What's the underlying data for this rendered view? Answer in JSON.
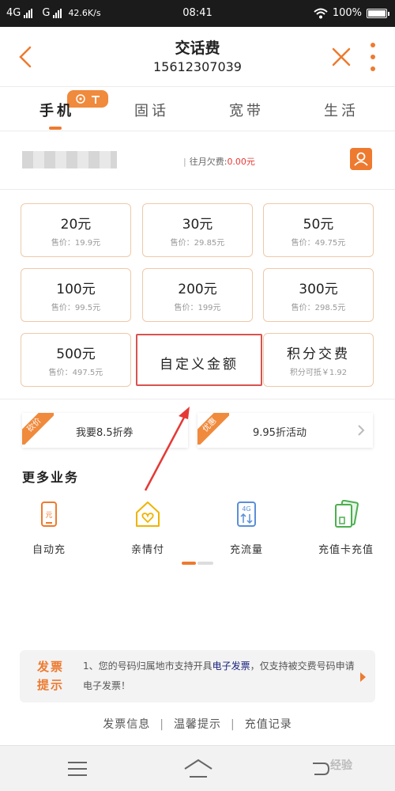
{
  "status_bar": {
    "network_1": "4G",
    "network_2": "G",
    "speed": "42.6K/s",
    "time": "08:41",
    "battery": "100%"
  },
  "header": {
    "title": "交话费",
    "phone_number": "15612307039"
  },
  "tabs": [
    {
      "label": "手机",
      "active": true
    },
    {
      "label": "固话",
      "active": false
    },
    {
      "label": "宽带",
      "active": false
    },
    {
      "label": "生活",
      "active": false
    }
  ],
  "account": {
    "arrears_label": "往月欠费:",
    "arrears_amount": "0.00元"
  },
  "amounts": [
    {
      "amount": "20元",
      "price": "售价：19.9元"
    },
    {
      "amount": "30元",
      "price": "售价：29.85元"
    },
    {
      "amount": "50元",
      "price": "售价：49.75元"
    },
    {
      "amount": "100元",
      "price": "售价：99.5元"
    },
    {
      "amount": "200元",
      "price": "售价：199元"
    },
    {
      "amount": "300元",
      "price": "售价：298.5元"
    },
    {
      "amount": "500元",
      "price": "售价：497.5元"
    }
  ],
  "custom_amount": "自定义金额",
  "points_card": {
    "title": "积分交费",
    "subtitle": "积分可抵￥1.92"
  },
  "promos": [
    {
      "ribbon": "砍价",
      "text": "我要8.5折券"
    },
    {
      "ribbon": "优惠",
      "text": "9.95折活动"
    }
  ],
  "more_services": {
    "title": "更多业务",
    "items": [
      {
        "label": "自动充",
        "icon": "phone-recharge-icon"
      },
      {
        "label": "亲情付",
        "icon": "family-home-icon"
      },
      {
        "label": "充流量",
        "icon": "data-4g-icon"
      },
      {
        "label": "充值卡充值",
        "icon": "recharge-card-icon"
      }
    ]
  },
  "notice": {
    "tag": "发票提示",
    "text_before": "1、您的号码归属地市支持开具",
    "highlight": "电子发票",
    "text_after": "，仅支持被交费号码申请电子发票！"
  },
  "footer_links": [
    "发票信息",
    "温馨提示",
    "充值记录"
  ],
  "watermark": "经验",
  "colors": {
    "accent": "#ee7a2f",
    "highlight_box": "#d9534f",
    "arrow": "#e53935"
  }
}
